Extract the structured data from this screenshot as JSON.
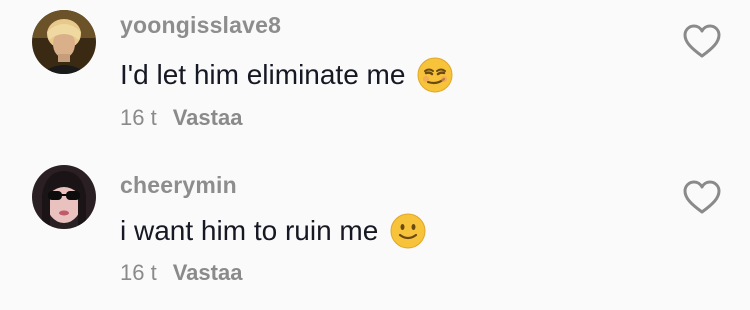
{
  "comments": [
    {
      "username": "yoongisslave8",
      "text": "I'd let him eliminate me",
      "emoji": "smirk-emoji",
      "time": "16 t",
      "reply_label": "Vastaa",
      "like_icon": "heart-outline-icon"
    },
    {
      "username": "cheerymin",
      "text": "i want him to ruin me",
      "emoji": "slight-smile-emoji",
      "time": "16 t",
      "reply_label": "Vastaa",
      "like_icon": "heart-outline-icon"
    }
  ],
  "colors": {
    "background": "#fafafa",
    "username": "#8d8d8d",
    "text": "#161823",
    "meta": "#8a8a8a",
    "emoji_yellow": "#f7c33a"
  }
}
